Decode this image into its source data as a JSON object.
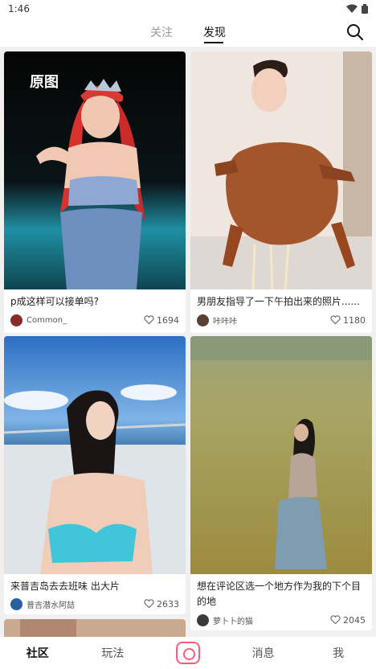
{
  "status_bar": {
    "time": "1:46"
  },
  "top_nav": {
    "tabs": [
      {
        "label": "关注",
        "active": false
      },
      {
        "label": "发现",
        "active": true
      }
    ]
  },
  "feed": {
    "cards": [
      {
        "badge": "原图",
        "title": "p成这样可以接单吗?",
        "author": "Common_",
        "likes": "1694"
      },
      {
        "title": "男朋友指导了一下午拍出来的照片......",
        "author": "咔咔咔",
        "likes": "1180"
      },
      {
        "title": "来普吉岛去去班味 出大片",
        "author": "普吉潜水阿喆",
        "likes": "2633"
      },
      {
        "title": "想在评论区选一个地方作为我的下个目的地",
        "author": "萝卜卜的猫",
        "likes": "2045"
      }
    ]
  },
  "bottom_nav": {
    "items": [
      {
        "label": "社区",
        "active": true
      },
      {
        "label": "玩法",
        "active": false
      },
      {
        "label": "消息",
        "active": false
      },
      {
        "label": "我",
        "active": false
      }
    ]
  },
  "colors": {
    "accent": "#ff5a7a",
    "text": "#222222",
    "muted": "#999999"
  }
}
